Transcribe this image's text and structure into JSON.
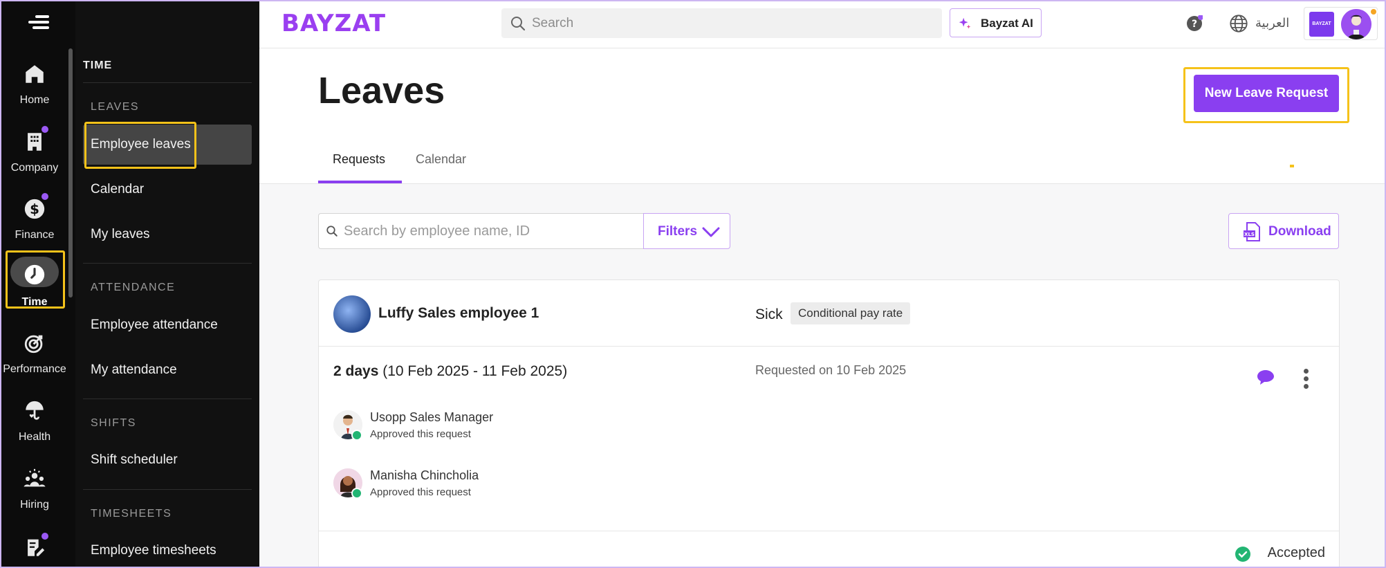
{
  "app": {
    "brand": "BAYZAT",
    "search_placeholder": "Search",
    "ai_button": "Bayzat AI",
    "language": "العربية",
    "company_badge": "BAYZAT"
  },
  "rail": {
    "items": [
      {
        "label": "Home",
        "icon": "home-icon"
      },
      {
        "label": "Company",
        "icon": "building-icon"
      },
      {
        "label": "Finance",
        "icon": "dollar-icon"
      },
      {
        "label": "Time",
        "icon": "clock-icon"
      },
      {
        "label": "Performance",
        "icon": "target-icon"
      },
      {
        "label": "Health",
        "icon": "umbrella-heart-icon"
      },
      {
        "label": "Hiring",
        "icon": "people-icon"
      }
    ]
  },
  "submenu": {
    "title": "TIME",
    "sections": [
      {
        "title": "LEAVES",
        "items": [
          "Employee leaves",
          "Calendar",
          "My leaves"
        ]
      },
      {
        "title": "ATTENDANCE",
        "items": [
          "Employee attendance",
          "My attendance"
        ]
      },
      {
        "title": "SHIFTS",
        "items": [
          "Shift scheduler"
        ]
      },
      {
        "title": "TIMESHEETS",
        "items": [
          "Employee timesheets"
        ]
      }
    ]
  },
  "page": {
    "title": "Leaves",
    "new_leave_button": "New Leave Request",
    "tabs": [
      "Requests",
      "Calendar"
    ],
    "employee_search_placeholder": "Search by employee name, ID",
    "filters_label": "Filters",
    "download_label": "Download"
  },
  "request": {
    "employee_name": "Luffy Sales employee 1",
    "leave_type": "Sick",
    "pay_tag": "Conditional pay rate",
    "duration_bold": "2 days",
    "duration_range": "(10 Feb 2025 - 11 Feb 2025)",
    "requested_on": "Requested on 10 Feb 2025",
    "approvers": [
      {
        "name": "Usopp Sales Manager",
        "status": "Approved this request"
      },
      {
        "name": "Manisha Chincholia",
        "status": "Approved this request"
      }
    ],
    "status": "Accepted"
  },
  "colors": {
    "accent": "#8a3ff0",
    "highlight": "#f5c21a",
    "success": "#22b573"
  }
}
